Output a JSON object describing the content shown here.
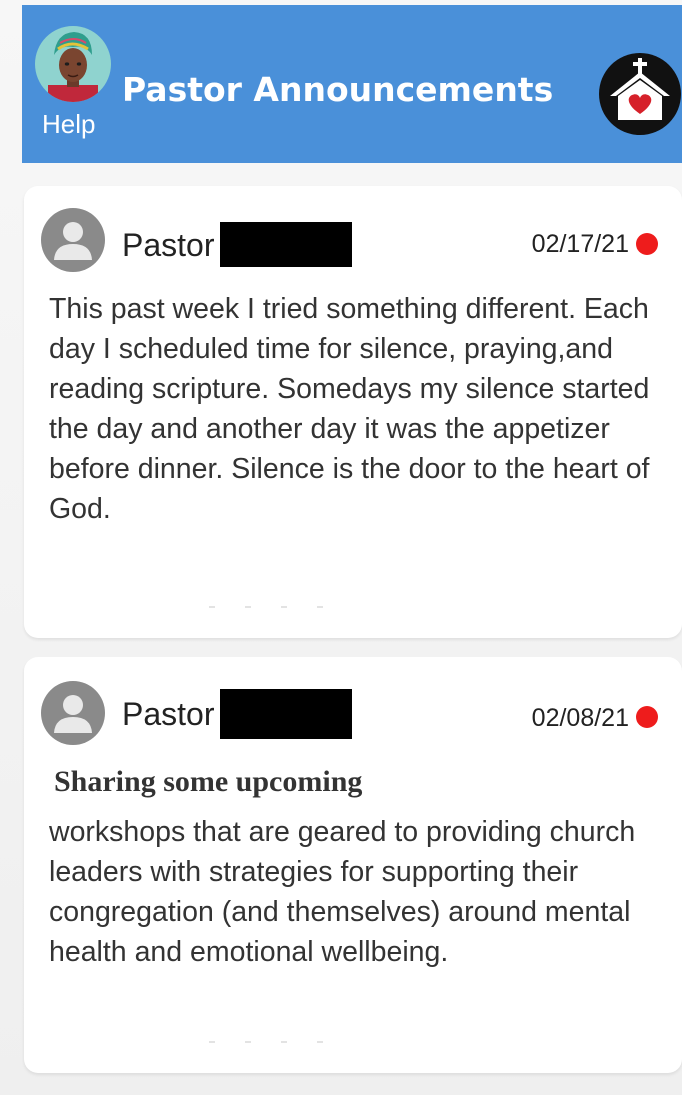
{
  "header": {
    "title": "Pastor Announcements",
    "help_label": "Help",
    "background_color": "#4a90d9"
  },
  "icons": {
    "help_avatar": "woman-avatar-icon",
    "church": "church-heart-icon",
    "author_avatar": "default-user-icon",
    "unread": "red-dot-unread-indicator"
  },
  "announcements": [
    {
      "author_title": "Pastor",
      "author_name_redacted": true,
      "date": "02/17/21",
      "unread": true,
      "heading": "",
      "body": "This past week I tried something different. Each day I scheduled time for silence, praying,and reading scripture. Somedays my silence started the day and another day it was the appetizer before dinner. Silence is the door to the heart of God."
    },
    {
      "author_title": "Pastor",
      "author_name_redacted": true,
      "date": "02/08/21",
      "unread": true,
      "heading": "Sharing some upcoming",
      "body": "workshops that are geared to providing church leaders with strategies for supporting their congregation (and themselves) around mental health and emotional wellbeing."
    }
  ],
  "colors": {
    "unread_dot": "#ee1c1c",
    "redaction": "#000000"
  }
}
